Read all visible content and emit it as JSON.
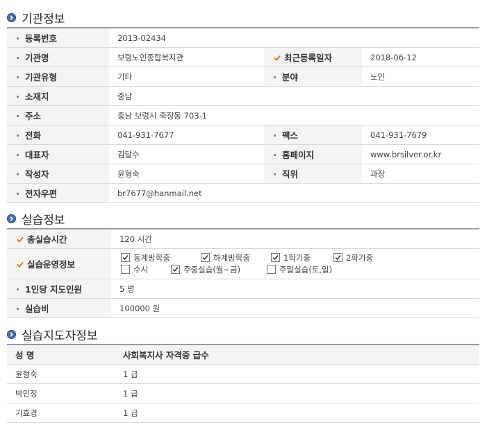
{
  "sections": {
    "org": "기관정보",
    "practice": "실습정보",
    "supervisor": "실습지도자정보"
  },
  "org": {
    "reg_no": {
      "label": "등록번호",
      "value": "2013-02434"
    },
    "name": {
      "label": "기관명",
      "value": "보령노인종합복지관"
    },
    "last_reg": {
      "label": "최근등록일자",
      "value": "2018-06-12"
    },
    "type": {
      "label": "기관유형",
      "value": "기타"
    },
    "field": {
      "label": "분야",
      "value": "노인"
    },
    "location": {
      "label": "소재지",
      "value": "충남"
    },
    "address": {
      "label": "주소",
      "value": "충남 보령시 죽정동 703-1"
    },
    "phone": {
      "label": "전화",
      "value": "041-931-7677"
    },
    "fax": {
      "label": "팩스",
      "value": "041-931-7679"
    },
    "rep": {
      "label": "대표자",
      "value": "김달수"
    },
    "homepage": {
      "label": "홈페이지",
      "value": "www.brsilver.or.kr"
    },
    "writer": {
      "label": "작성자",
      "value": "윤형숙"
    },
    "position": {
      "label": "직위",
      "value": "과장"
    },
    "email": {
      "label": "전자우편",
      "value": "br7677@hanmail.net"
    }
  },
  "practice": {
    "hours": {
      "label": "총실습시간",
      "value": "120 시간"
    },
    "ops": {
      "label": "실습운영정보",
      "options": [
        {
          "label": "동계방학중",
          "checked": true
        },
        {
          "label": "하계방학중",
          "checked": true
        },
        {
          "label": "1학기중",
          "checked": true
        },
        {
          "label": "2학기중",
          "checked": true
        },
        {
          "label": "수시",
          "checked": false
        },
        {
          "label": "주중실습(월~금)",
          "checked": true
        },
        {
          "label": "주말실습(토,일)",
          "checked": false
        }
      ]
    },
    "per_person": {
      "label": "1인당 지도인원",
      "value": "5 명"
    },
    "fee": {
      "label": "실습비",
      "value": "100000 원"
    }
  },
  "supervisor": {
    "headers": [
      "성 명",
      "사회복지사 자격증 급수"
    ],
    "rows": [
      {
        "name": "윤형숙",
        "grade": "1 급"
      },
      {
        "name": "박민정",
        "grade": "1 급"
      },
      {
        "name": "기효경",
        "grade": "1 급"
      }
    ]
  },
  "colors": {
    "accent_check": "#e07a1f",
    "bullet": "#4a6fb0"
  }
}
